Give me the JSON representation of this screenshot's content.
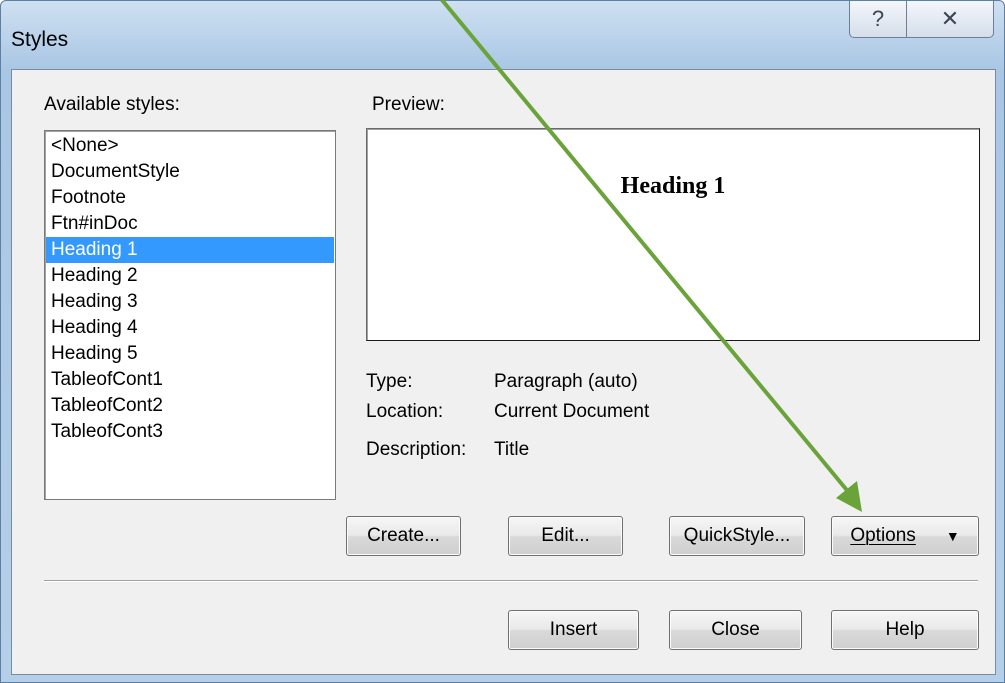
{
  "window": {
    "title": "Styles",
    "help_glyph": "?",
    "close_glyph": "✕"
  },
  "available_styles": {
    "label": "Available styles:",
    "items": [
      "<None>",
      "DocumentStyle",
      "Footnote",
      "Ftn#inDoc",
      "Heading 1",
      "Heading 2",
      "Heading 3",
      "Heading 4",
      "Heading 5",
      "TableofCont1",
      "TableofCont2",
      "TableofCont3"
    ],
    "selected": "Heading 1"
  },
  "preview": {
    "label": "Preview:",
    "sample_text": "Heading 1"
  },
  "info": {
    "type_label": "Type:",
    "type_value": "Paragraph (auto)",
    "location_label": "Location:",
    "location_value": "Current Document",
    "description_label": "Description:",
    "description_value": "Title"
  },
  "buttons": {
    "create": "Create...",
    "edit": "Edit...",
    "quickstyle": "QuickStyle...",
    "options": "Options",
    "options_caret": "▼",
    "insert": "Insert",
    "close": "Close",
    "help": "Help"
  },
  "annotation": {
    "arrow_color": "#6aa33a"
  }
}
